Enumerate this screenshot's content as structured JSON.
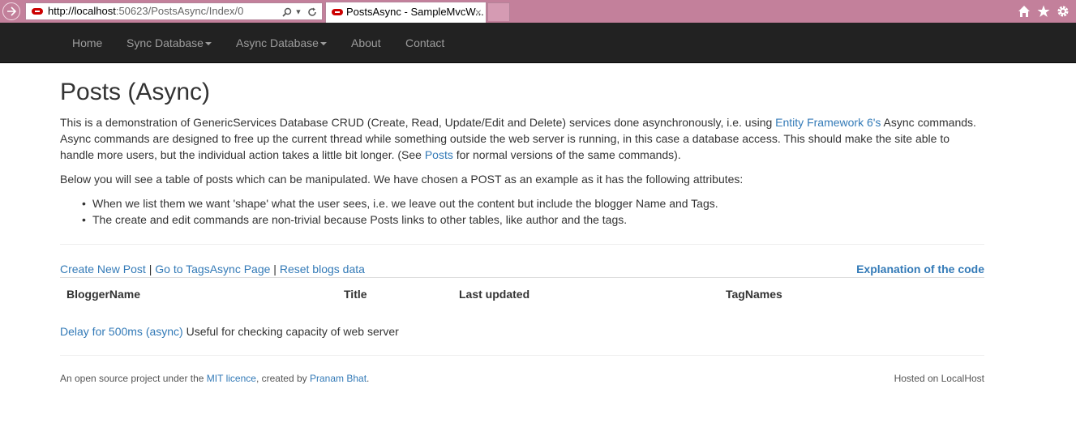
{
  "browser": {
    "url_host": "http://localhost",
    "url_path": ":50623/PostsAsync/Index/0",
    "tab_title": "PostsAsync - SampleMvcW...",
    "tab_close": "×"
  },
  "nav": {
    "items": [
      "Home",
      "Sync Database",
      "Async Database",
      "About",
      "Contact"
    ]
  },
  "page": {
    "title": "Posts (Async)",
    "intro_part1": "This is a demonstration of GenericServices Database CRUD (Create, Read, Update/Edit and Delete) services done asynchronously, i.e. using ",
    "intro_link1": "Entity Framework 6's",
    "intro_part2": " Async commands. Async commands are designed to free up the current thread while something outside the web server is running, in this case a database access. This should make the site able to handle more users, but the individual action takes a little bit longer. (See ",
    "intro_link2": "Posts",
    "intro_part3": " for normal versions of the same commands).",
    "para2": "Below you will see a table of posts which can be manipulated. We have chosen a POST as an example as it has the following attributes:",
    "bullets": [
      "When we list them we want 'shape' what the user sees, i.e. we leave out the content but include the blogger Name and Tags.",
      "The create and edit commands are non-trivial because Posts links to other tables, like author and the tags."
    ],
    "actions": {
      "create": "Create New Post",
      "sep": " | ",
      "tags": "Go to TagsAsync Page",
      "reset": "Reset blogs data"
    },
    "explain": "Explanation of the code",
    "table_headers": [
      "BloggerName",
      "Title",
      "Last updated",
      "TagNames"
    ],
    "delay_link": "Delay for 500ms (async)",
    "delay_text": " Useful for checking capacity of web server"
  },
  "footer": {
    "left_part1": "An open source project under the ",
    "left_link1": "MIT licence",
    "left_part2": ", created by ",
    "left_link2": "Pranam Bhat",
    "left_part3": ".",
    "right": "Hosted on LocalHost"
  },
  "colors": {
    "chrome": "#c3809b",
    "navbar": "#222222",
    "link": "#337ab7"
  }
}
